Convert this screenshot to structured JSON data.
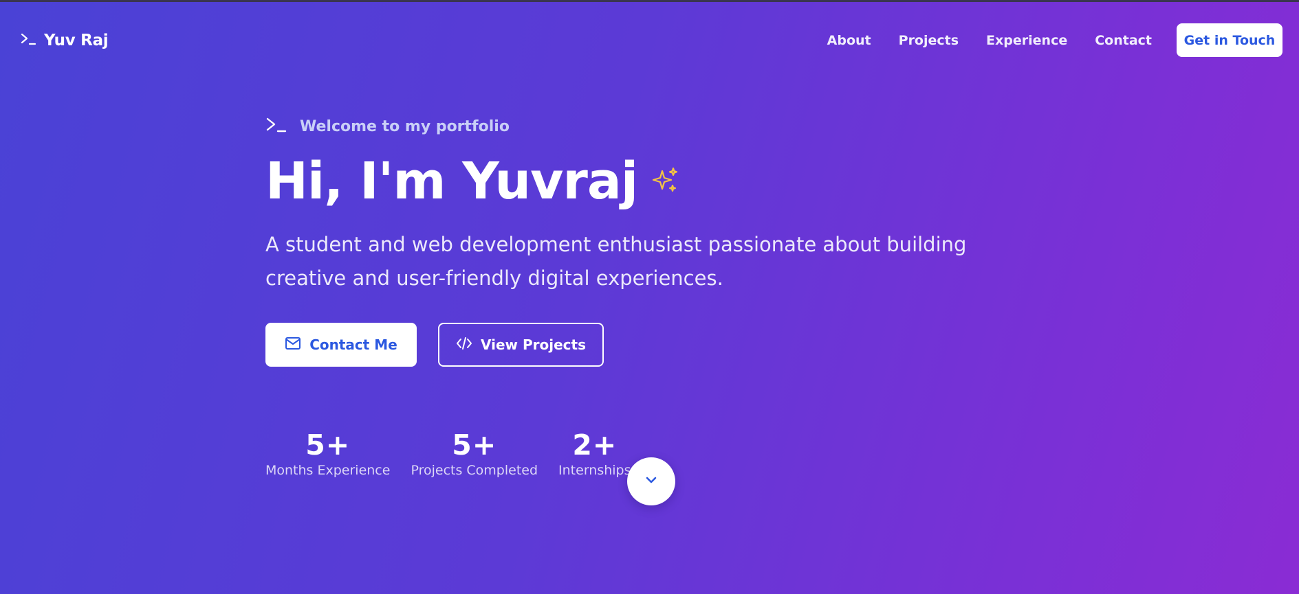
{
  "nav": {
    "brand": "Yuv Raj",
    "links": [
      "About",
      "Projects",
      "Experience",
      "Contact"
    ],
    "cta": "Get in Touch"
  },
  "hero": {
    "welcome": "Welcome to my portfolio",
    "headline": "Hi, I'm Yuvraj",
    "subtitle": "A student and web development enthusiast passionate about building creative and user-friendly digital experiences.",
    "primary_button": "Contact Me",
    "secondary_button": "View Projects"
  },
  "stats": [
    {
      "value": "5+",
      "label": "Months Experience"
    },
    {
      "value": "5+",
      "label": "Projects Completed"
    },
    {
      "value": "2+",
      "label": "Internships"
    }
  ],
  "icons": {
    "brand": "terminal-icon",
    "welcome": "terminal-icon",
    "headline": "sparkles-icon",
    "primary_button": "mail-icon",
    "secondary_button": "code-icon",
    "scroll": "chevron-down-icon"
  },
  "colors": {
    "gradient_start": "#4a42d6",
    "gradient_end": "#8a2cd4",
    "accent_blue": "#2b58e0",
    "sparkle": "#f5c542"
  }
}
